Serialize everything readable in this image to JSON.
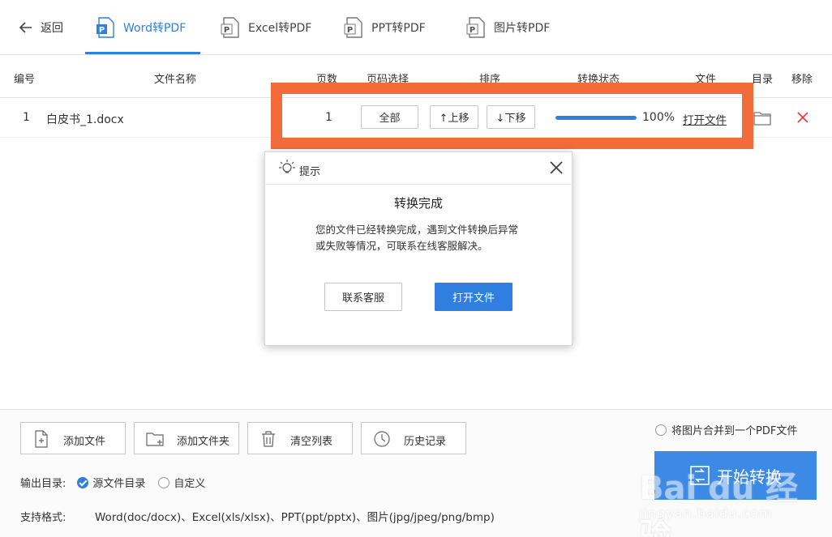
{
  "nav": {
    "back_label": "返回",
    "tabs": [
      {
        "label": "Word转PDF",
        "icon": "word-file-icon",
        "active": true
      },
      {
        "label": "Excel转PDF",
        "icon": "excel-file-icon",
        "active": false
      },
      {
        "label": "PPT转PDF",
        "icon": "ppt-file-icon",
        "active": false
      },
      {
        "label": "图片转PDF",
        "icon": "image-file-icon",
        "active": false
      }
    ]
  },
  "table": {
    "headers": {
      "index": "编号",
      "filename": "文件名称",
      "pages": "页数",
      "page_select": "页码选择",
      "order": "排序",
      "status": "转换状态",
      "file": "文件",
      "folder": "目录",
      "remove": "移除"
    },
    "rows": [
      {
        "index": "1",
        "filename": "白皮书_1.docx",
        "pages": "1",
        "page_select_label": "全部",
        "move_up_label": "↑上移",
        "move_down_label": "↓下移",
        "progress_percent": 100,
        "progress_label": "100%",
        "open_file_label": "打开文件"
      }
    ]
  },
  "dialog": {
    "header": "提示",
    "title": "转换完成",
    "message": "您的文件已经转换完成，遇到文件转换后异常或失败等情况，可联系在线客服解决。",
    "contact_label": "联系客服",
    "open_label": "打开文件"
  },
  "bottom": {
    "add_file": "添加文件",
    "add_folder": "添加文件夹",
    "clear_list": "清空列表",
    "history": "历史记录",
    "merge_images": "将图片合并到一个PDF文件",
    "output_dir_label": "输出目录:",
    "source_dir": "源文件目录",
    "custom": "自定义",
    "formats_label": "支持格式:",
    "formats_value": "Word(doc/docx)、Excel(xls/xlsx)、PPT(ppt/pptx)、图片(jpg/jpeg/png/bmp)",
    "start_label": "开始转换"
  },
  "watermark": {
    "main": "Bai du 经验",
    "sub": "jingyan.baidu.com"
  },
  "colors": {
    "accent": "#2f7fe0",
    "highlight": "#f26b3a",
    "remove": "#e53935"
  }
}
